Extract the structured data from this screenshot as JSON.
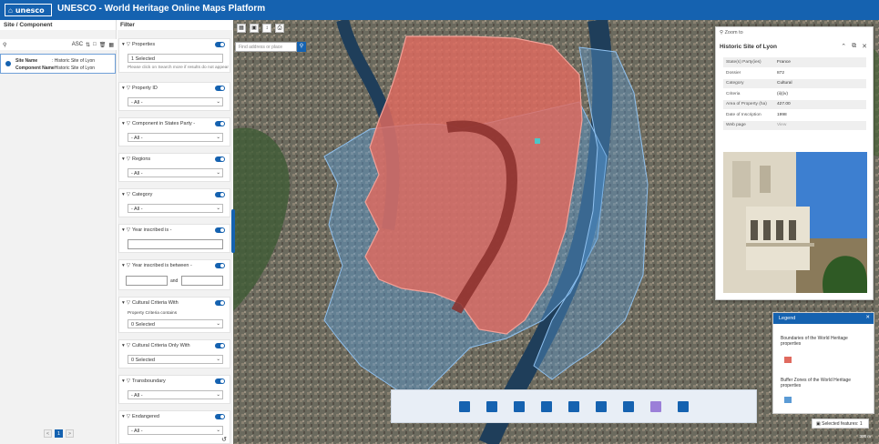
{
  "header": {
    "logo_mark": "⌂",
    "logo_text": "unesco",
    "title": "UNESCO - World Heritage Online Maps Platform"
  },
  "left_panel": {
    "title": "Site / Component",
    "sort_label": "ASC",
    "result": {
      "site_name_label": "Site Name",
      "site_name_value": ": Historic Site of Lyon",
      "component_name_label": "Component Name",
      "component_name_value": ": Historic Site of Lyon"
    },
    "pager": {
      "prev": "<",
      "current": "1",
      "next": ">"
    }
  },
  "filter_panel": {
    "title": "Filter",
    "filters": [
      {
        "label": "Properties",
        "value": "1 Selected",
        "note": "Please click on Search more if results do not appear"
      },
      {
        "label": "Property ID",
        "value": "- All -"
      },
      {
        "label": "Component in States Party -",
        "value": "- All -"
      },
      {
        "label": "Regions",
        "value": "- All -"
      },
      {
        "label": "Category",
        "value": "- All -"
      },
      {
        "label": "Year inscribed is -",
        "value": ""
      },
      {
        "label": "Year inscribed is between -",
        "and_label": "and"
      },
      {
        "label": "Cultural Criteria With",
        "note": "Property Criteria contains",
        "value": "0 Selected"
      },
      {
        "label": "Cultural Criteria Only With",
        "value": "0 Selected"
      },
      {
        "label": "Transboundary",
        "value": "- All -"
      },
      {
        "label": "Endangered",
        "value": "- All -"
      }
    ]
  },
  "map": {
    "search_placeholder": "Find address or place",
    "popup": {
      "zoom_label": "Zoom to",
      "title": "Historic Site of Lyon",
      "attributes": [
        {
          "key": "State(s) Party(ies)",
          "value": "France"
        },
        {
          "key": "Dossier",
          "value": "872"
        },
        {
          "key": "Category",
          "value": "Cultural"
        },
        {
          "key": "Criteria",
          "value": "(ii)(iv)"
        },
        {
          "key": "Area of Property (ha)",
          "value": "427.00"
        },
        {
          "key": "Date of Inscription",
          "value": "1998"
        },
        {
          "key": "Web page",
          "value": "View"
        }
      ]
    },
    "legend": {
      "title": "Legend",
      "items": [
        {
          "label": "Boundaries of the World Heritage properties",
          "color": "#e06a5f"
        },
        {
          "label": "Buffer Zones of the World Heritage properties",
          "color": "#5b9bd5"
        }
      ]
    },
    "selected_features": "Selected features: 1",
    "scale_label": "300 m",
    "colors": {
      "property": "#e06a5f",
      "buffer": "#5b9bd5",
      "river": "#1f3e5a"
    }
  }
}
